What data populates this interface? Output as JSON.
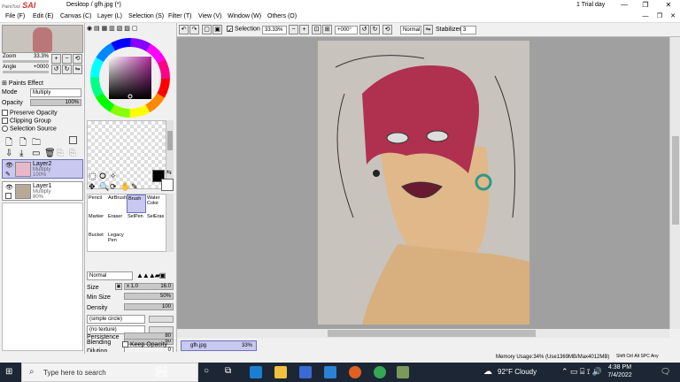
{
  "window": {
    "app_logo": "PaintTool SAI",
    "title": "Desktop / gfh.jpg (*)",
    "trial": "1 Trial day",
    "buttons": {
      "minimize": "—",
      "maximize": "❐",
      "close": "✕"
    }
  },
  "menu": [
    "File (F)",
    "Edit (E)",
    "Canvas (C)",
    "Layer (L)",
    "Selection (S)",
    "Filter (T)",
    "View (V)",
    "Window (W)",
    "Others (O)"
  ],
  "navigator": {
    "zoom_label": "Zoom",
    "zoom_value": "33.3%",
    "angle_label": "Angle",
    "angle_value": "+0000"
  },
  "layer_panel": {
    "paints_effect": "Paints Effect",
    "mode_label": "Mode",
    "mode_value": "Multiply",
    "opacity_label": "Opacity",
    "opacity_value": "100%",
    "preserve_opacity": "Preserve Opacity",
    "clipping_group": "Clipping Group",
    "selection_source": "Selection Source",
    "layers": [
      {
        "name": "Layer2",
        "mode": "Multiply",
        "opacity": "100%",
        "selected": true
      },
      {
        "name": "Layer1",
        "mode": "Multiply",
        "opacity": "80%",
        "selected": false
      }
    ]
  },
  "tools": {
    "cells": [
      "Pencil",
      "AirBrush",
      "Brush",
      "Water Color",
      "Marker",
      "Eraser",
      "SelPen",
      "SelEras",
      "Bucket",
      "Legacy Pen"
    ],
    "selected": "Brush",
    "blend_mode": "Normal",
    "size_label": "Size",
    "size_mult": "x 1.0",
    "size_value": "16.0",
    "min_size_label": "Min Size",
    "min_size_value": "50%",
    "density_label": "Density",
    "density_value": "100",
    "shape": "(simple circle)",
    "texture": "(no texture)",
    "blending_label": "Blending",
    "blending_value": "50",
    "dilution_label": "Dilution",
    "dilution_value": "0",
    "persistence_label": "Persistence",
    "persistence_value": "80",
    "keep_opacity": "Keep Opacity"
  },
  "toolbar": {
    "selection": "Selection",
    "zoom": "33.33%",
    "angle": "+000°",
    "mode": "Normal",
    "stabilizer_label": "Stabilizer",
    "stabilizer_value": "3"
  },
  "tab": {
    "name": "gfh.jpg",
    "zoom": "33%"
  },
  "status": {
    "memory": "Memory Usage:34% (Use1369MB/Max4012MB)",
    "keys": [
      "Shift",
      "Ctrl",
      "Alt",
      "SPC",
      "Any"
    ]
  },
  "taskbar": {
    "search_placeholder": "Type here to search",
    "weather": "92°F  Cloudy",
    "time": "4:38 PM",
    "date": "7/4/2022"
  },
  "colors": {
    "accent": "#c33",
    "selected_layer": "#c8c8f0",
    "taskbar": "#1c2635"
  }
}
